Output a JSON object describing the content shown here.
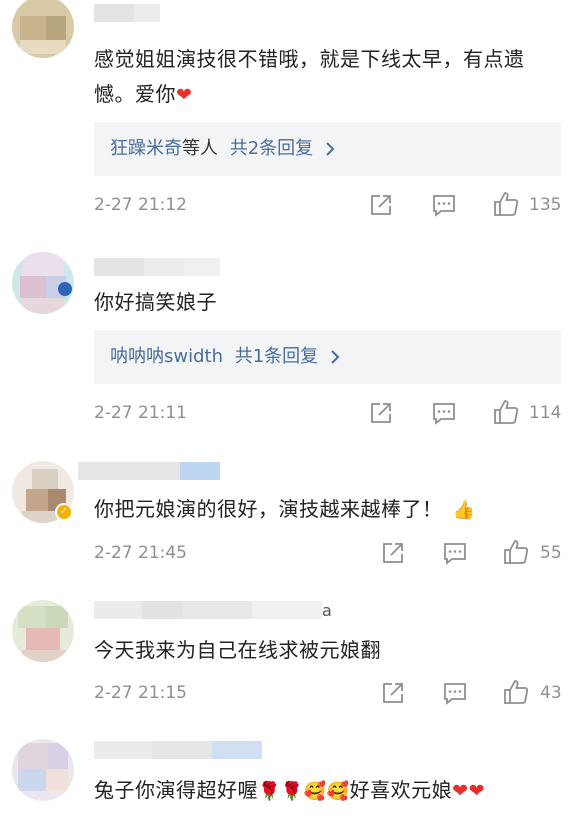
{
  "comments": [
    {
      "text": "感觉姐姐演技很不错哦，就是下线太早，有点遗憾。爱你",
      "emoji_suffix": "❤",
      "replies": {
        "names": "狂躁米奇",
        "middle": "等人",
        "count_text": "共2条回复"
      },
      "time": "2-27 21:12",
      "likes": "135"
    },
    {
      "text": "你好搞笑娘子",
      "replies": {
        "names": "呐呐呐swidth",
        "middle": "",
        "count_text": "共1条回复"
      },
      "time": "2-27 21:11",
      "likes": "114"
    },
    {
      "text": "你把元娘演的很好，演技越来越棒了！",
      "emoji_suffix": "👍",
      "time": "2-27 21:45",
      "likes": "55"
    },
    {
      "text": "今天我来为自己在线求被元娘翻",
      "name_tail": "a",
      "time": "2-27 21:15",
      "likes": "43"
    },
    {
      "text": "兔子你演得超好喔",
      "emoji_mid": "🌹🌹🥰🥰",
      "text_tail": "好喜欢元娘",
      "emoji_suffix": "❤❤"
    }
  ],
  "icons": {
    "share": "share-icon",
    "comment": "comment-icon",
    "like": "thumbs-up-icon",
    "chevron": "chevron-right-icon"
  },
  "colors": {
    "link": "#4a6d9c",
    "meta": "#8f8f8f",
    "reply_bg": "#f3f4f6",
    "heart": "#e8302a",
    "verified": "#f6b100"
  }
}
